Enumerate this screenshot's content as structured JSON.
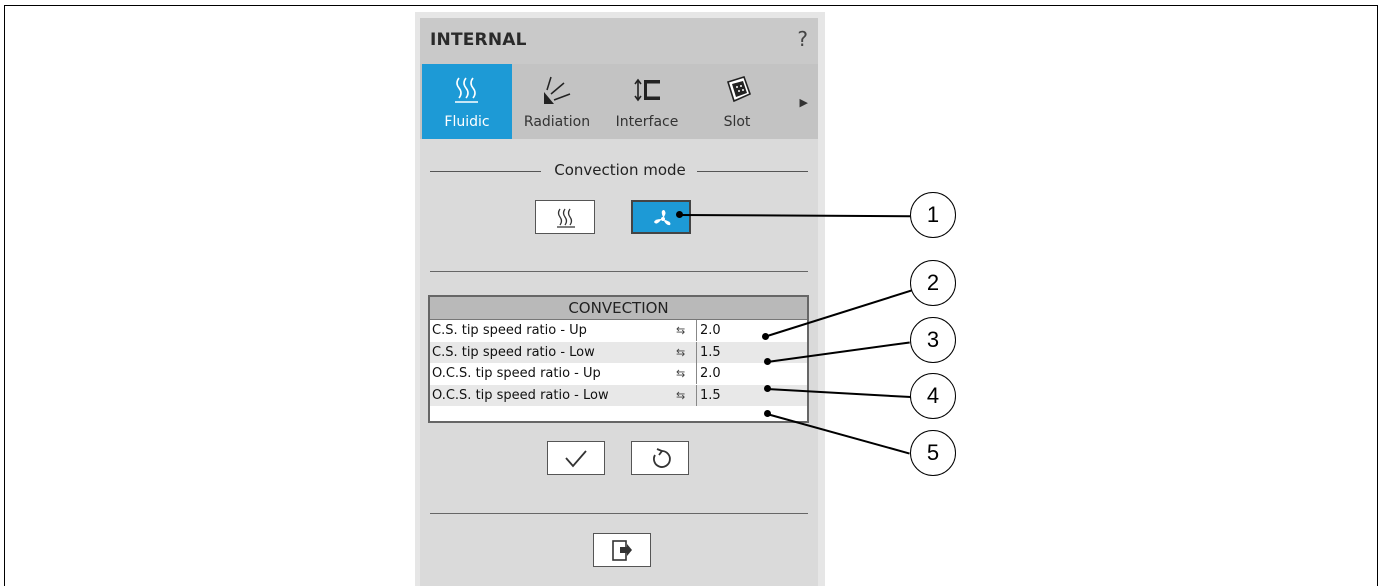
{
  "panel": {
    "title": "INTERNAL",
    "help_icon": "?"
  },
  "tabs": [
    {
      "label": "Fluidic",
      "icon": "heat-waves-icon",
      "active": true
    },
    {
      "label": "Radiation",
      "icon": "radiation-icon",
      "active": false
    },
    {
      "label": "Interface",
      "icon": "interface-icon",
      "active": false
    },
    {
      "label": "Slot",
      "icon": "slot-icon",
      "active": false
    }
  ],
  "convection_mode": {
    "label": "Convection mode",
    "options": [
      {
        "icon": "natural-convection-icon",
        "active": false
      },
      {
        "icon": "fan-icon",
        "active": true
      }
    ]
  },
  "convection_table": {
    "header": "CONVECTION",
    "rows": [
      {
        "name": "C.S. tip speed ratio - Up",
        "value": "2.0"
      },
      {
        "name": "C.S. tip speed ratio - Low",
        "value": "1.5"
      },
      {
        "name": "O.C.S. tip speed ratio - Up",
        "value": "2.0"
      },
      {
        "name": "O.C.S. tip speed ratio - Low",
        "value": "1.5"
      }
    ]
  },
  "callouts": [
    "1",
    "2",
    "3",
    "4",
    "5"
  ],
  "colors": {
    "accent": "#1d9ad6",
    "panel_bg": "#dadada",
    "tab_bar": "#c3c3c3"
  }
}
